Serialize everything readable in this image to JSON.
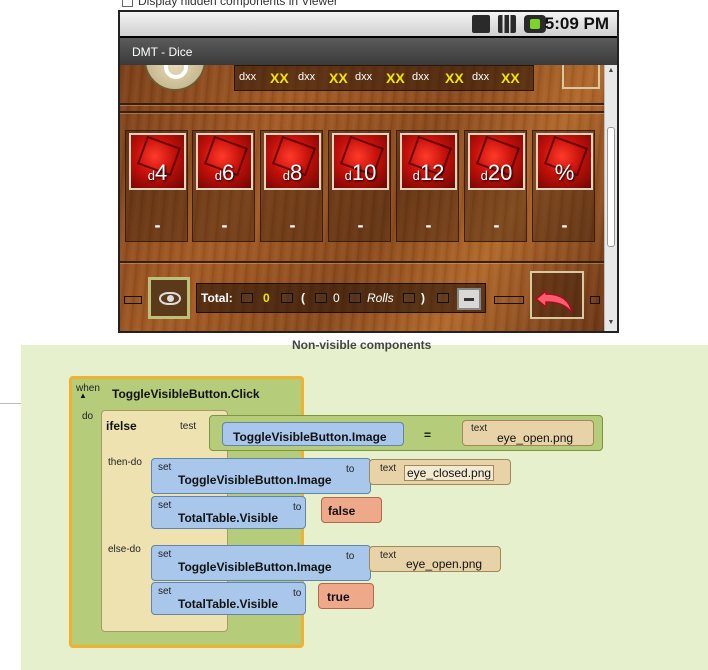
{
  "viewer_option": {
    "label": "Display hidden components in Viewer"
  },
  "phone": {
    "status_time": "5:09 PM",
    "app_title": "DMT - Dice",
    "summary": [
      {
        "label": "dxx",
        "value": "XX"
      },
      {
        "label": "dxx",
        "value": "XX"
      },
      {
        "label": "dxx",
        "value": "XX"
      },
      {
        "label": "dxx",
        "value": "XX"
      },
      {
        "label": "dxx",
        "value": "XX"
      }
    ],
    "dice": [
      {
        "prefix": "d",
        "num": "4",
        "value": "-"
      },
      {
        "prefix": "d",
        "num": "6",
        "value": "-"
      },
      {
        "prefix": "d",
        "num": "8",
        "value": "-"
      },
      {
        "prefix": "d",
        "num": "10",
        "value": "-"
      },
      {
        "prefix": "d",
        "num": "12",
        "value": "-"
      },
      {
        "prefix": "d",
        "num": "20",
        "value": "-"
      },
      {
        "prefix": "",
        "num": "%",
        "value": "-"
      }
    ],
    "total": {
      "label": "Total:",
      "value": "0",
      "open_paren": "(",
      "rolls_value": "0",
      "rolls_label": "Rolls",
      "close_paren": ")"
    }
  },
  "nonvisible_label": "Non-visible components",
  "blocks": {
    "event": {
      "when": "when",
      "name": "ToggleVisibleButton.Click",
      "do": "do"
    },
    "ifelse": {
      "label": "ifelse",
      "test": "test",
      "then_do": "then-do",
      "else_do": "else-do"
    },
    "compare": {
      "getter": "ToggleVisibleButton.Image",
      "op": "=",
      "text_tag": "text",
      "text_value": "eye_open.png"
    },
    "then_set_image": {
      "set": "set",
      "target": "ToggleVisibleButton.Image",
      "to": "to",
      "text_tag": "text",
      "value": "eye_closed.png"
    },
    "then_set_visible": {
      "set": "set",
      "target": "TotalTable.Visible",
      "to": "to",
      "value": "false"
    },
    "else_set_image": {
      "set": "set",
      "target": "ToggleVisibleButton.Image",
      "to": "to",
      "text_tag": "text",
      "value": "eye_open.png"
    },
    "else_set_visible": {
      "set": "set",
      "target": "TotalTable.Visible",
      "to": "to",
      "value": "true"
    }
  },
  "colors": {
    "event_block": "#b5cc7a",
    "event_outline": "#f0b030",
    "control_block": "#ede2b0",
    "setter_block": "#a9c7ea",
    "text_block": "#e8d3a8",
    "logic_block": "#eea98a",
    "compare_block": "#b5cc7a"
  }
}
